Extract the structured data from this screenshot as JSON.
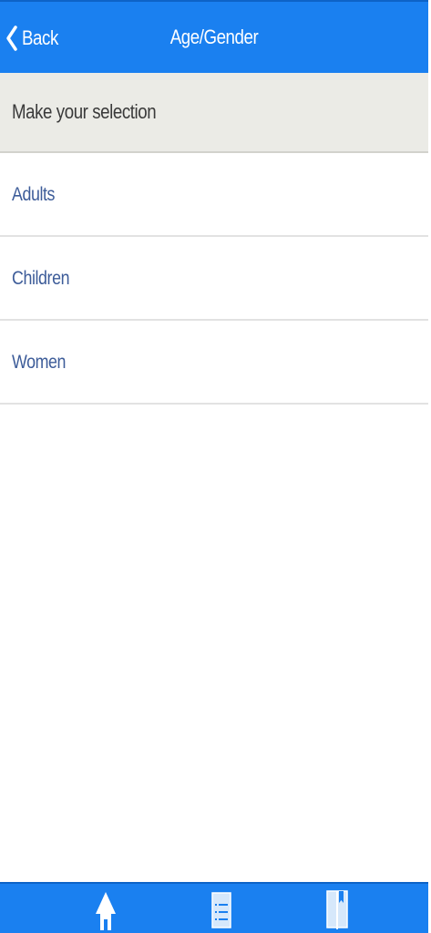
{
  "nav": {
    "back_label": "Back",
    "title": "Age/Gender"
  },
  "section_header": "Make your selection",
  "items": [
    {
      "label": "Adults"
    },
    {
      "label": "Children"
    },
    {
      "label": "Women"
    }
  ],
  "tab_bar": {
    "tabs": [
      {
        "icon": "home-icon"
      },
      {
        "icon": "list-icon"
      },
      {
        "icon": "book-icon"
      }
    ]
  },
  "colors": {
    "nav_background": "#1a80f0",
    "section_header_background": "#ebebe6",
    "item_text": "#3d5c99",
    "tab_bar_background": "#1a80f0"
  }
}
